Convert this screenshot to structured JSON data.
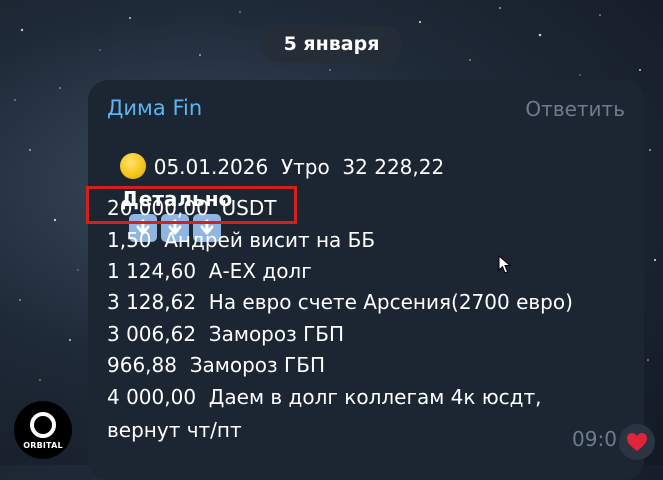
{
  "date_separator": "5 января",
  "message": {
    "author": "Дима Fin",
    "reply_label": "Ответить",
    "header_line": "05.01.2026  Утро  32 228,22",
    "detail_label": "Детально",
    "lines": [
      "20 000,00  USDT",
      "1,50  Андрей висит на ББ",
      "1 124,60  А-EX долг",
      "3 128,62  На евро счете Арсения(2700 евро)",
      "3 006,62  Замороз ГБП",
      "966,88  Замороз ГБП",
      "4 000,00  Даем в долг коллегам 4к юсдт,",
      "вернут чт/пт"
    ],
    "time": "09:0"
  },
  "avatar": {
    "label": "ORBITAL"
  },
  "icons": {
    "coin": "yellow-circle-emoji",
    "arrows": "down-arrow-emoji",
    "reaction": "heart-icon"
  },
  "colors": {
    "accent_name": "#5db4f0",
    "bubble": "#1c2633",
    "highlight": "#d41f1f"
  }
}
